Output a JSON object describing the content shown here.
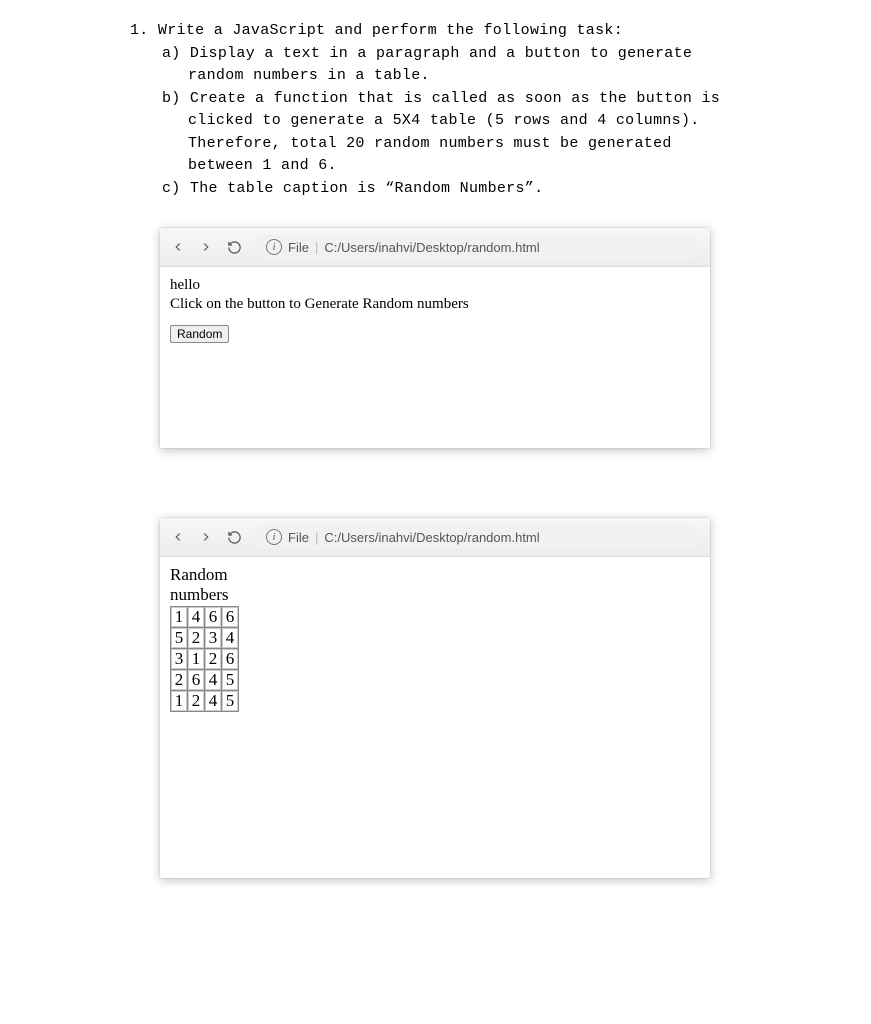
{
  "question": {
    "number": "1.",
    "stem": "Write a JavaScript and perform the following task:",
    "items": [
      {
        "label": "a)",
        "lines": [
          "Display a text in a paragraph and a button to generate",
          "random numbers in a table."
        ]
      },
      {
        "label": "b)",
        "lines": [
          "Create a function that is called as soon as the button is",
          "clicked to generate a 5X4 table (5 rows and 4 columns).",
          "Therefore, total 20 random numbers must be generated",
          "between 1 and 6."
        ]
      },
      {
        "label": "c)",
        "lines": [
          "The table caption is “Random Numbers”."
        ]
      }
    ]
  },
  "browser1": {
    "addr_file": "File",
    "addr_url": "C:/Users/inahvi/Desktop/random.html",
    "line1": "hello",
    "line2": "Click on the button to Generate Random numbers",
    "button_label": "Random"
  },
  "browser2": {
    "addr_file": "File",
    "addr_url": "C:/Users/inahvi/Desktop/random.html",
    "caption": "Random numbers"
  },
  "chart_data": {
    "type": "table",
    "title": "Random numbers",
    "rows": 5,
    "cols": 4,
    "values": [
      [
        1,
        4,
        6,
        6
      ],
      [
        5,
        2,
        3,
        4
      ],
      [
        3,
        1,
        2,
        6
      ],
      [
        2,
        6,
        4,
        5
      ],
      [
        1,
        2,
        4,
        5
      ]
    ]
  }
}
